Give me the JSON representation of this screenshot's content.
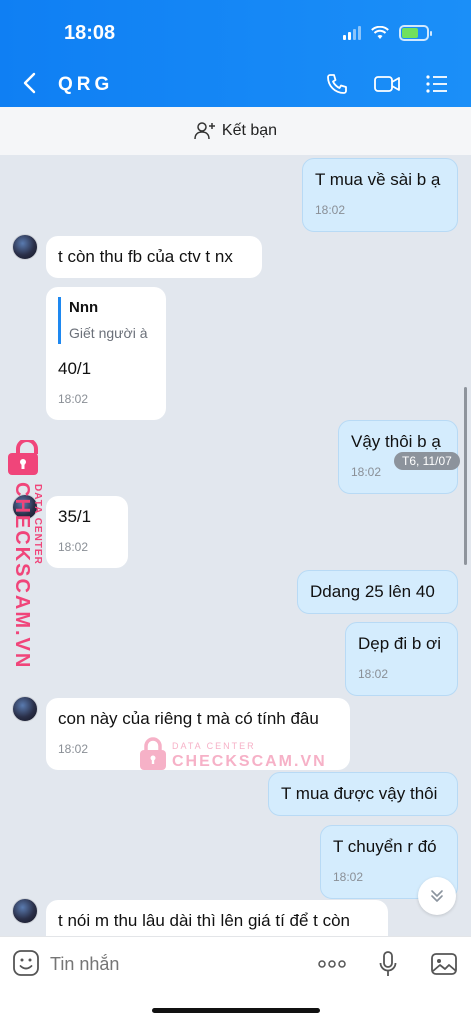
{
  "status": {
    "time": "18:08"
  },
  "header": {
    "title": "QRG"
  },
  "add_friend": {
    "label": "Kết bạn"
  },
  "messages": [
    {
      "text": "T mua về sài b ạ",
      "time": "18:02"
    },
    {
      "text": "t còn thu fb của ctv t nx"
    },
    {
      "quote_name": "Nnn",
      "quote_text": "Giết người à",
      "text": "40/1",
      "time": "18:02"
    },
    {
      "text": "Vậy thôi b ạ",
      "time": "18:02"
    },
    {
      "text": "35/1",
      "time": "18:02"
    },
    {
      "text": "Ddang 25 lên 40"
    },
    {
      "text": "Dẹp đi b ơi",
      "time": "18:02"
    },
    {
      "text": "con này của riêng t mà có tính đâu",
      "time": "18:02"
    },
    {
      "text": "T mua được vậy thôi"
    },
    {
      "text": "T chuyển r đó",
      "time": "18:02"
    },
    {
      "text": "t nói m thu lâu dài thì lên giá tí để t còn"
    }
  ],
  "date_pill": "T6, 11/07",
  "watermark": {
    "top": "DATA CENTER",
    "bottom": "CHECKSCAM.VN"
  },
  "input": {
    "placeholder": "Tin nhắn"
  },
  "colors": {
    "accent": "#0f7ff3",
    "bubble_out": "#d4ecfd",
    "watermark": "#f0457a"
  },
  "icons": [
    "back-icon",
    "phone-icon",
    "video-icon",
    "menu-icon",
    "add-friend-icon",
    "sticker-icon",
    "more-icon",
    "mic-icon",
    "image-icon",
    "scroll-down-icon"
  ]
}
